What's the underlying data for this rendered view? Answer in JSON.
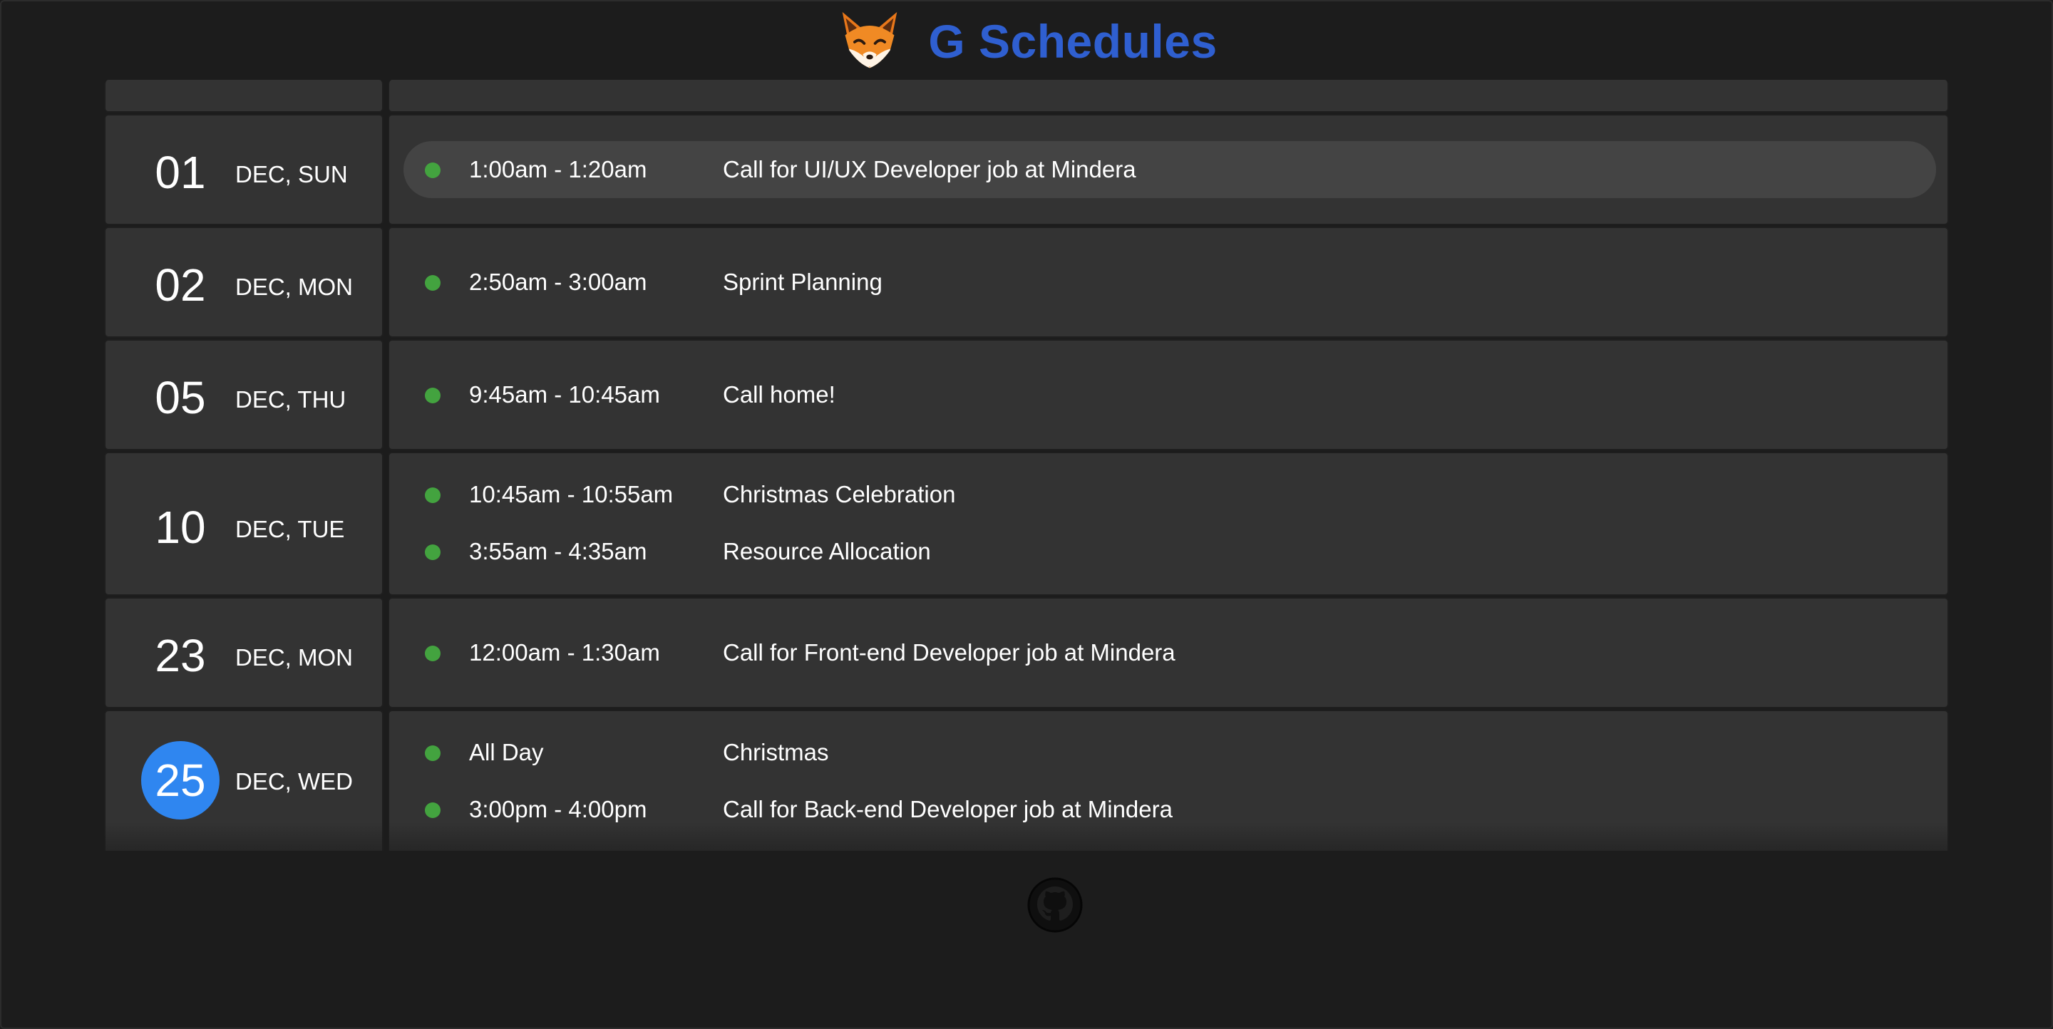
{
  "header": {
    "app_title": "G Schedules",
    "logo_icon": "fox-icon"
  },
  "agenda": {
    "days": [
      {
        "day": "01",
        "label": "DEC, SUN",
        "today": false,
        "events": [
          {
            "time": "1:00am - 1:20am",
            "title": "Call for UI/UX Developer job at Mindera",
            "status_color": "#43a33f",
            "hovered": true
          }
        ]
      },
      {
        "day": "02",
        "label": "DEC, MON",
        "today": false,
        "events": [
          {
            "time": "2:50am - 3:00am",
            "title": "Sprint Planning",
            "status_color": "#43a33f"
          }
        ]
      },
      {
        "day": "05",
        "label": "DEC, THU",
        "today": false,
        "events": [
          {
            "time": "9:45am - 10:45am",
            "title": "Call home!",
            "status_color": "#43a33f"
          }
        ]
      },
      {
        "day": "10",
        "label": "DEC, TUE",
        "today": false,
        "events": [
          {
            "time": "10:45am - 10:55am",
            "title": "Christmas Celebration",
            "status_color": "#43a33f"
          },
          {
            "time": "3:55am - 4:35am",
            "title": "Resource Allocation",
            "status_color": "#43a33f"
          }
        ]
      },
      {
        "day": "23",
        "label": "DEC, MON",
        "today": false,
        "events": [
          {
            "time": "12:00am - 1:30am",
            "title": "Call for Front-end Developer job at Mindera",
            "status_color": "#43a33f"
          }
        ]
      },
      {
        "day": "25",
        "label": "DEC, WED",
        "today": true,
        "events": [
          {
            "time": "All Day",
            "title": "Christmas",
            "status_color": "#43a33f"
          },
          {
            "time": "3:00pm - 4:00pm",
            "title": "Call for Back-end Developer job at Mindera",
            "status_color": "#43a33f"
          }
        ]
      }
    ]
  },
  "footer": {
    "github_icon": "github-icon"
  },
  "colors": {
    "background": "#1c1c1c",
    "row": "#333333",
    "accent": "#2f5fd0",
    "today": "#2f86f0",
    "event_dot": "#43a33f"
  }
}
